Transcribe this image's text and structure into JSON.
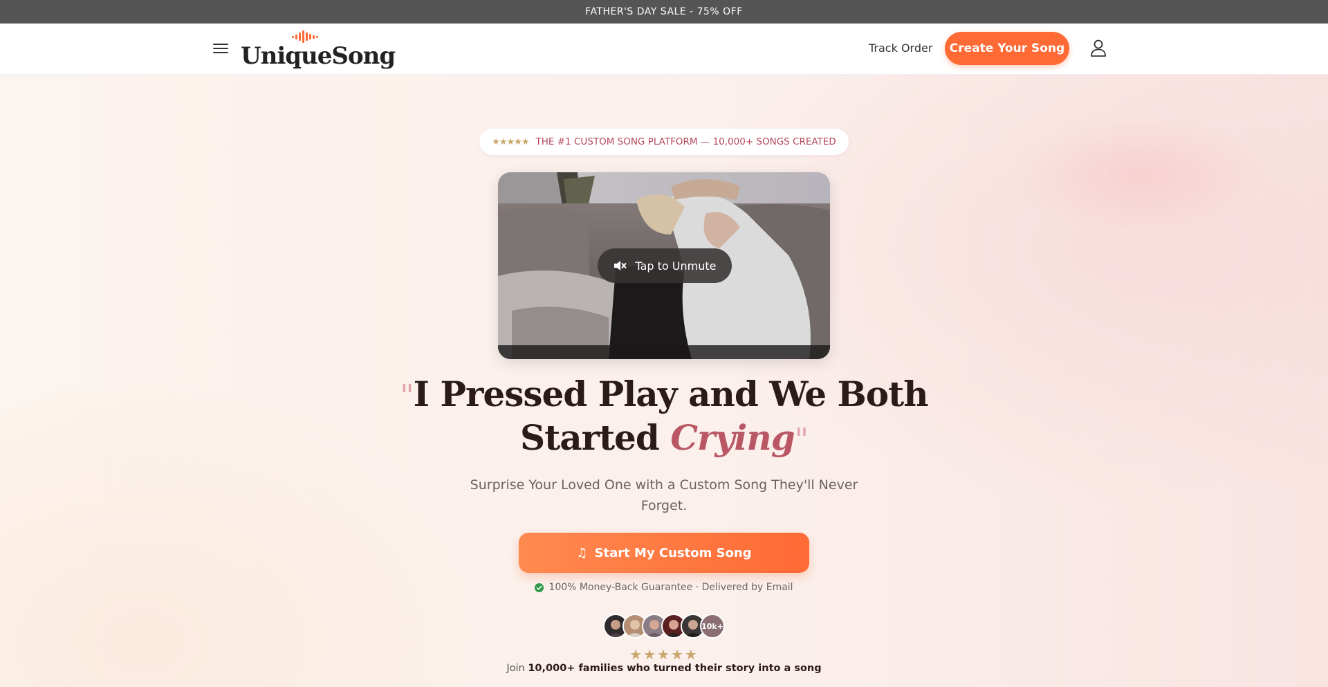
{
  "announcement": {
    "text": "FATHER'S DAY SALE - 75% OFF"
  },
  "header": {
    "logo_text": "UniqueSong",
    "track_order": "Track Order",
    "create_button": "Create Your Song"
  },
  "hero": {
    "badge": {
      "stars": "★★★★★",
      "text": "THE #1 CUSTOM SONG PLATFORM — 10,000+ SONGS CREATED"
    },
    "video": {
      "unmute_label": "Tap to Unmute"
    },
    "headline": {
      "open_quote": "\"",
      "line1": "I Pressed Play and We Both",
      "line2_prefix": "Started",
      "line2_emphasis": "Crying",
      "close_quote": "\""
    },
    "subtitle": "Surprise Your Loved One with a Custom Song They'll Never Forget.",
    "cta": {
      "icon": "♫",
      "label": "Start My Custom Song"
    },
    "guarantee": "100% Money-Back Guarantee · Delivered by Email",
    "social_proof": {
      "avatar_count_label": "10k+",
      "rating_stars": "★★★★★",
      "join_prefix": "Join",
      "join_bold": "10,000+ families who turned their story into a song"
    }
  },
  "colors": {
    "accent": "#ff6a35",
    "announcement_bg": "#555555",
    "badge_text": "#b4475a",
    "emphasis": "#b95764",
    "star": "#c9a66b",
    "check": "#2e9a4a"
  }
}
